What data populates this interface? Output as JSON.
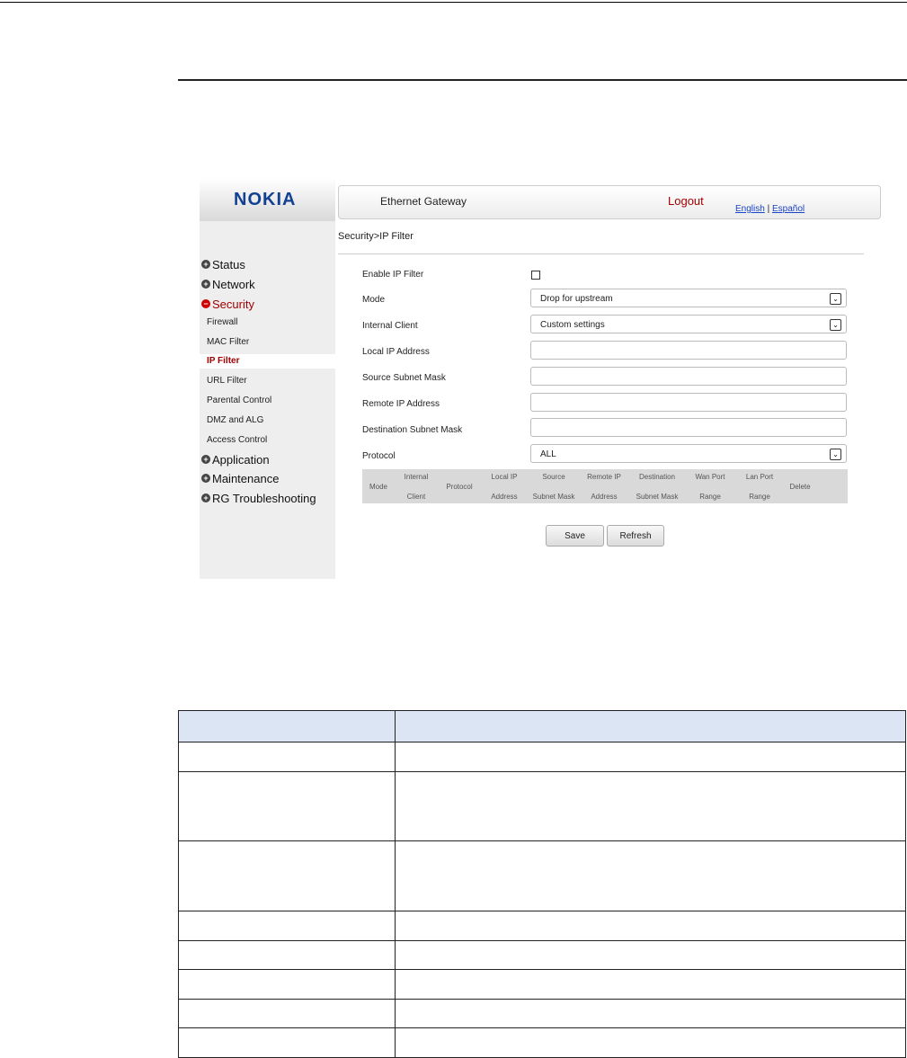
{
  "screenshot": {
    "logo_text": "NOKIA",
    "header": {
      "title": "Ethernet Gateway",
      "logout_label": "Logout",
      "lang_english": "English",
      "lang_separator": " | ",
      "lang_spanish": "Español"
    },
    "sidebar": {
      "status": "Status",
      "network": "Network",
      "security": "Security",
      "security_items": [
        "Firewall",
        "MAC Filter",
        "IP Filter",
        "URL Filter",
        "Parental Control",
        "DMZ and ALG",
        "Access Control"
      ],
      "application": "Application",
      "maintenance": "Maintenance",
      "rg_troubleshooting": "RG Troubleshooting"
    },
    "breadcrumb": "Security>IP Filter",
    "form": {
      "enable_label": "Enable IP Filter",
      "enable_checked": false,
      "mode_label": "Mode",
      "mode_value": "Drop for upstream",
      "internal_client_label": "Internal Client",
      "internal_client_value": "Custom settings",
      "local_ip_label": "Local IP Address",
      "local_ip_value": "",
      "source_mask_label": "Source Subnet Mask",
      "source_mask_value": "",
      "remote_ip_label": "Remote IP Address",
      "remote_ip_value": "",
      "dest_mask_label": "Destination Subnet Mask",
      "dest_mask_value": "",
      "protocol_label": "Protocol",
      "protocol_value": "ALL"
    },
    "rules_table_headers": [
      [
        "Mode"
      ],
      [
        "Internal",
        "Client"
      ],
      [
        "Protocol"
      ],
      [
        "Local IP",
        "Address"
      ],
      [
        "Source",
        "Subnet Mask"
      ],
      [
        "Remote IP",
        "Address"
      ],
      [
        "Destination",
        "Subnet Mask"
      ],
      [
        "Wan Port",
        "Range"
      ],
      [
        "Lan Port",
        "Range"
      ],
      [
        "Delete"
      ]
    ],
    "save_label": "Save",
    "refresh_label": "Refresh"
  },
  "colors": {
    "brand": "#124191",
    "active_red": "#a10000",
    "link_blue": "#1a44c8",
    "doc_table_header": "#dbe5f4"
  }
}
